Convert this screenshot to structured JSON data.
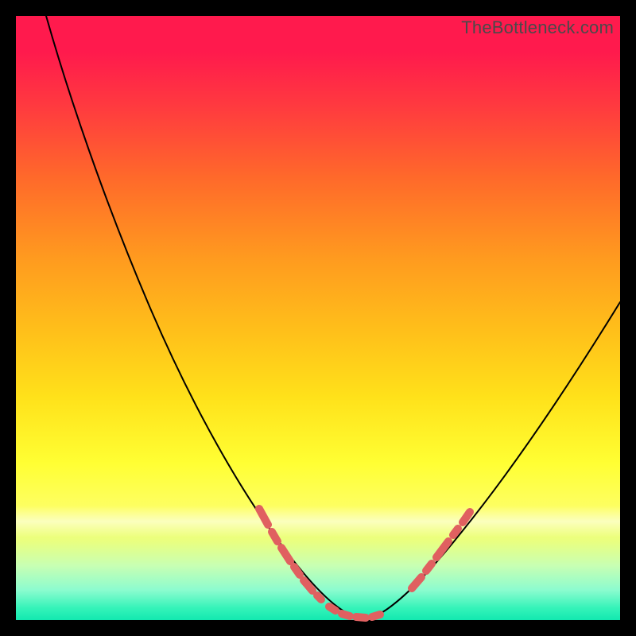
{
  "watermark": "TheBottleneck.com",
  "colors": {
    "page_bg": "#000000",
    "gradient_top": "#ff1a4d",
    "gradient_bottom": "#12e8b0",
    "curve": "#000000",
    "dash": "#e06060",
    "watermark": "#4a4a4a"
  },
  "chart_data": {
    "type": "line",
    "title": "",
    "xlabel": "",
    "ylabel": "",
    "xlim": [
      0,
      100
    ],
    "ylim": [
      0,
      100
    ],
    "grid": false,
    "legend": false,
    "series": [
      {
        "name": "bottleneck-curve",
        "x": [
          5,
          10,
          15,
          20,
          25,
          30,
          35,
          40,
          45,
          47.5,
          50,
          52.5,
          55,
          57.5,
          60,
          65,
          70,
          75,
          80,
          85,
          90,
          95,
          100
        ],
        "y": [
          100,
          90,
          79,
          68,
          57,
          46,
          36,
          26,
          16,
          11,
          5,
          2,
          0,
          0,
          1,
          4,
          9,
          15,
          22,
          30,
          38,
          46,
          54
        ]
      }
    ],
    "annotations": [
      {
        "type": "dashed-threshold-band",
        "y_range": [
          0,
          22
        ],
        "note": "salmon dashed segments overlaid on curve near trough"
      }
    ]
  }
}
